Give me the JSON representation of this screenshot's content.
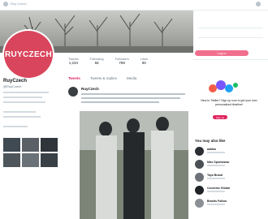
{
  "browser": {
    "tab_label": "Ruy Czech"
  },
  "profile": {
    "avatar_text": "RUYCZECH",
    "name": "RuyCzech",
    "handle": "@RuyCzech"
  },
  "stats": [
    {
      "label": "Tweets",
      "value": "1,234"
    },
    {
      "label": "Following",
      "value": "56"
    },
    {
      "label": "Followers",
      "value": "789"
    },
    {
      "label": "Likes",
      "value": "90"
    }
  ],
  "tabs": [
    {
      "label": "Tweets",
      "active": true
    },
    {
      "label": "Tweets & replies",
      "active": false
    },
    {
      "label": "Media",
      "active": false
    }
  ],
  "tweet": {
    "author": "RuyCzech"
  },
  "right": {
    "signup_label": "Log in",
    "promo_title": "New to Twitter? Sign up now to get your own personalized timeline!",
    "promo_button": "Sign up"
  },
  "follow": {
    "title": "You may also like",
    "items": [
      {
        "name": "adidas"
      },
      {
        "name": "Nike Sportswear"
      },
      {
        "name": "Tayo Brand"
      },
      {
        "name": "Converse Global"
      },
      {
        "name": "Brands Follow"
      }
    ]
  },
  "colors": {
    "accent": "#e0245e",
    "avatar": "#d9455c",
    "signup": "#f06f8d"
  }
}
